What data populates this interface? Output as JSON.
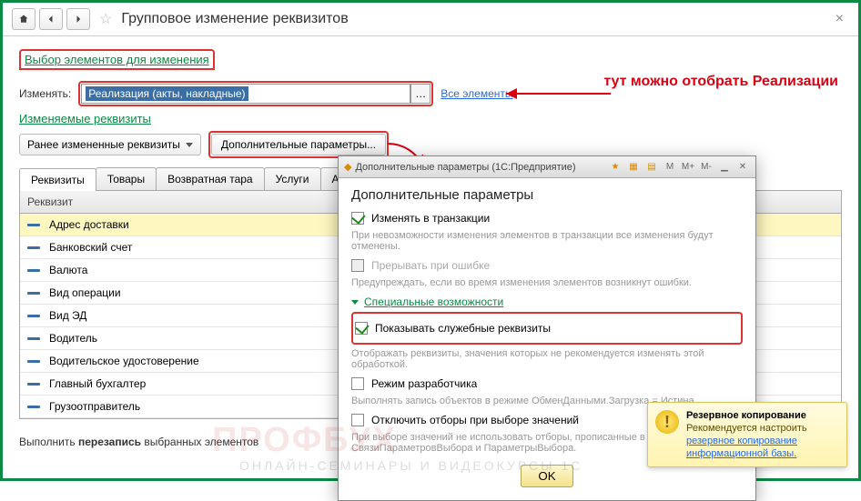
{
  "header": {
    "title": "Групповое изменение реквизитов"
  },
  "section1": {
    "title": "Выбор элементов для изменения",
    "change_label": "Изменять:",
    "selected_value": "Реализация (акты, накладные)",
    "all_elements_link": "Все элементы"
  },
  "annotation": "тут можно отобрать Реализации",
  "section2": {
    "title": "Изменяемые реквизиты",
    "prev_changed_label": "Ранее измененные реквизиты",
    "extra_params_label": "Дополнительные параметры..."
  },
  "tabs": [
    "Реквизиты",
    "Товары",
    "Возвратная тара",
    "Услуги",
    "Агентские"
  ],
  "active_tab": 0,
  "grid": {
    "header": "Реквизит",
    "rows": [
      "Адрес доставки",
      "Банковский счет",
      "Валюта",
      "Вид операции",
      "Вид ЭД",
      "Водитель",
      "Водительское удостоверение",
      "Главный бухгалтер",
      "Грузоотправитель"
    ],
    "selected_index": 0
  },
  "bottom": {
    "prefix": "Выполнить ",
    "bold": "перезапись",
    "suffix": " выбранных элементов"
  },
  "dialog": {
    "title": "Дополнительные параметры  (1С:Предприятие)",
    "heading": "Дополнительные параметры",
    "transact_label": "Изменять в транзакции",
    "transact_hint": "При невозможности изменения элементов в транзакции все изменения будут отменены.",
    "abort_label": "Прерывать при ошибке",
    "abort_hint": "Предупреждать, если во время изменения элементов возникнут ошибки.",
    "special_label": "Специальные возможности",
    "show_service_label": "Показывать служебные реквизиты",
    "show_service_hint": "Отображать реквизиты, значения которых не рекомендуется изменять этой обработкой.",
    "dev_mode_label": "Режим разработчика",
    "dev_mode_hint": "Выполнять запись объектов в режиме ОбменДанными.Загрузка = Истина.",
    "disable_filters_label": "Отключить отборы при выборе значений",
    "disable_filters_hint": "При выборе значений не использовать отборы, прописанные в свойствах СвязиПараметровВыбора и ПараметрыВыбора.",
    "ok_label": "OK",
    "titlebar_icons": [
      "M",
      "M+",
      "M-"
    ]
  },
  "toast": {
    "title": "Резервное копирование",
    "text": "Рекомендуется настроить",
    "link1": "резервное копирование",
    "link2": "информационной базы."
  },
  "watermark": {
    "main": "ПРОФБУХ",
    "sub": "ОНЛАЙН-СЕМИНАРЫ И ВИДЕОКУРСЫ 1С"
  }
}
